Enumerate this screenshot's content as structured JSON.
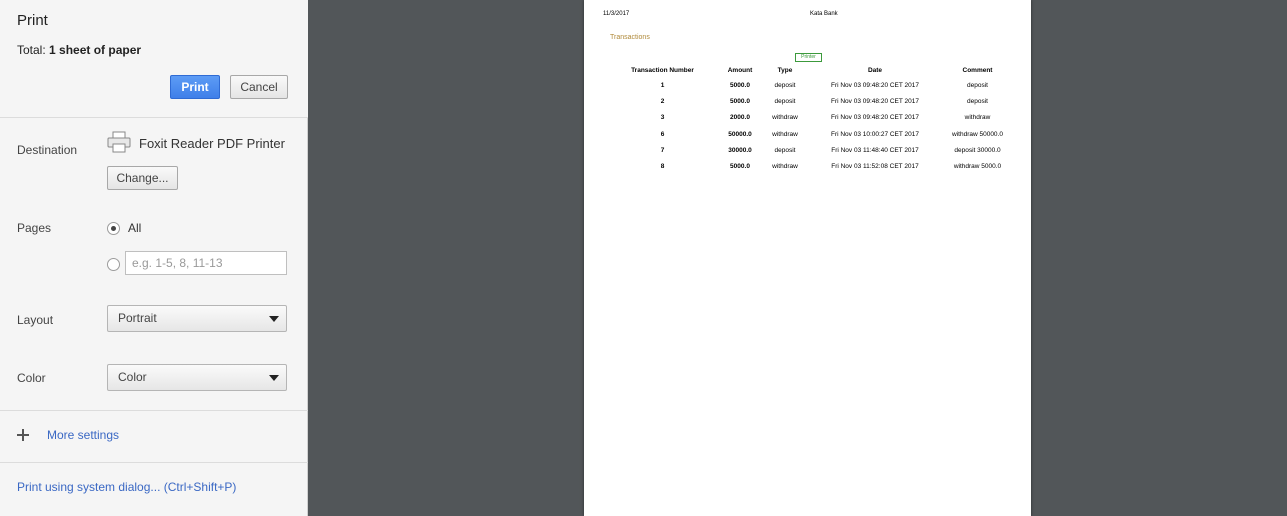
{
  "sidebar": {
    "title": "Print",
    "total_label": "Total:",
    "total_value": "1 sheet of paper",
    "print_button": "Print",
    "cancel_button": "Cancel",
    "destination": {
      "label": "Destination",
      "printer_name": "Foxit Reader PDF Printer",
      "change_button": "Change...",
      "icon": "printer-icon"
    },
    "pages": {
      "label": "Pages",
      "all_label": "All",
      "selected": "All",
      "custom_placeholder": "e.g. 1-5, 8, 11-13",
      "custom_value": ""
    },
    "layout": {
      "label": "Layout",
      "value": "Portrait"
    },
    "color": {
      "label": "Color",
      "value": "Color"
    },
    "more_settings": "More settings",
    "system_dialog": "Print using system dialog... (Ctrl+Shift+P)"
  },
  "preview": {
    "date": "11/3/2017",
    "bank_name": "Kata Bank",
    "heading": "Transactions",
    "printer_button": "Printer",
    "table": {
      "headers": [
        "Transaction Number",
        "Amount",
        "Type",
        "Date",
        "Comment"
      ],
      "rows": [
        [
          "1",
          "5000.0",
          "deposit",
          "Fri Nov 03 09:48:20 CET 2017",
          "deposit"
        ],
        [
          "2",
          "5000.0",
          "deposit",
          "Fri Nov 03 09:48:20 CET 2017",
          "deposit"
        ],
        [
          "3",
          "2000.0",
          "withdraw",
          "Fri Nov 03 09:48:20 CET 2017",
          "withdraw"
        ],
        [
          "6",
          "50000.0",
          "withdraw",
          "Fri Nov 03 10:00:27 CET 2017",
          "withdraw 50000.0"
        ],
        [
          "7",
          "30000.0",
          "deposit",
          "Fri Nov 03 11:48:40 CET 2017",
          "deposit 30000.0"
        ],
        [
          "8",
          "5000.0",
          "withdraw",
          "Fri Nov 03 11:52:08 CET 2017",
          "withdraw 5000.0"
        ]
      ]
    }
  },
  "colors": {
    "print_button": "#4285f4",
    "link": "#3a68c4",
    "preview_background": "#525659",
    "heading": "#b08a3a",
    "printer_button_border": "#3c9a3c"
  }
}
